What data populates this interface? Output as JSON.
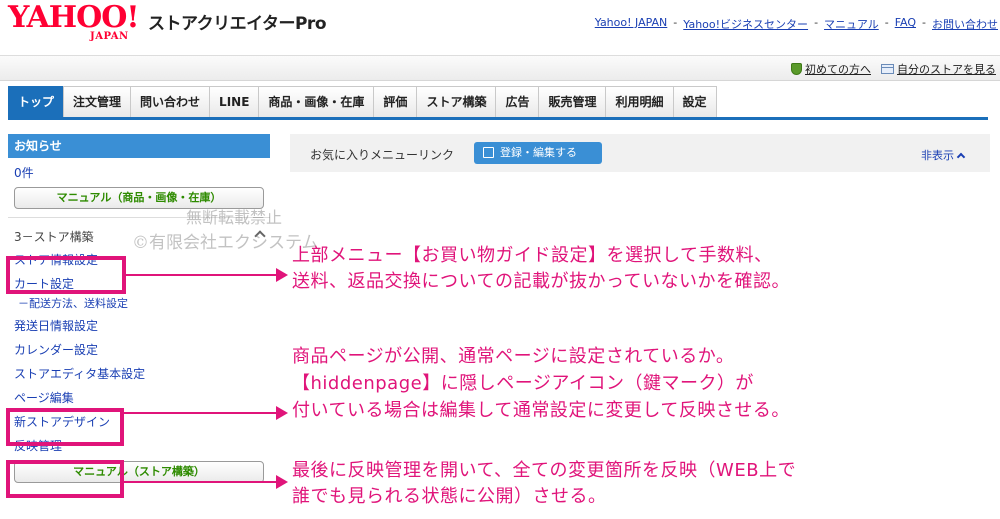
{
  "header": {
    "logo_text": "YAHOO!",
    "logo_sub": "JAPAN",
    "app_name": "ストアクリエイターPro",
    "links": [
      "Yahoo! JAPAN",
      "Yahoo!ビジネスセンター",
      "マニュアル",
      "FAQ",
      "お問い合わせ"
    ],
    "separator": "-"
  },
  "utilbar": {
    "first_time": "初めての方へ",
    "view_store": "自分のストアを見る"
  },
  "nav": {
    "tabs": [
      "トップ",
      "注文管理",
      "問い合わせ",
      "LINE",
      "商品・画像・在庫",
      "評価",
      "ストア構築",
      "広告",
      "販売管理",
      "利用明細",
      "設定"
    ]
  },
  "sidebar": {
    "notice_title": "お知らせ",
    "notice_count": "0件",
    "manual_products": "マニュアル（商品・画像・在庫）",
    "section_title": "3－ストア構築",
    "links": {
      "store_info": "ストア情報設定",
      "cart": "カート設定",
      "shipping": "－配送方法、送料設定",
      "ship_date": "発送日情報設定",
      "calendar": "カレンダー設定",
      "editor_basic": "ストアエディタ基本設定",
      "page_edit": "ページ編集",
      "new_design": "新ストアデザイン",
      "publish": "反映管理"
    },
    "manual_store": "マニュアル（ストア構築）"
  },
  "content": {
    "fav_label": "お気に入りメニューリンク",
    "fav_button": "登録・編集する",
    "hide_toggle": "非表示"
  },
  "watermark": {
    "line1": "無断転載禁止",
    "line2": "©有限会社エクシステム"
  },
  "annotations": {
    "note1_line1": "上部メニュー【お買い物ガイド設定】を選択して手数料、",
    "note1_line2": "送料、返品交換についての記載が抜かっていないかを確認。",
    "note2_line1": "商品ページが公開、通常ページに設定されているか。",
    "note2_line2": "【hiddenpage】に隠しページアイコン（鍵マーク）が",
    "note2_line3": "付いている場合は編集して通常設定に変更して反映させる。",
    "note3_line1": "最後に反映管理を開いて、全ての変更箇所を反映（WEB上で",
    "note3_line2": "誰でも見られる状態に公開）させる。"
  },
  "colors": {
    "brand_red": "#ff0033",
    "nav_blue": "#1b6fba",
    "highlight_pink": "#e0147a",
    "link_blue": "#1a3fb3"
  }
}
